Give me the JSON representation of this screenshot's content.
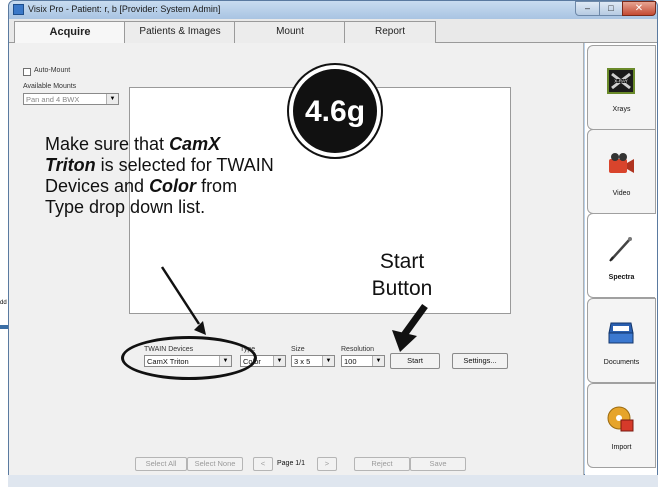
{
  "window": {
    "title": "Visix Pro - Patient: r, b [Provider: System Admin]"
  },
  "tabs": [
    {
      "label": "Acquire",
      "active": true
    },
    {
      "label": "Patients & Images",
      "active": false
    },
    {
      "label": "Mount",
      "active": false
    },
    {
      "label": "Report",
      "active": false
    }
  ],
  "left_panel": {
    "auto_mount_label": "Auto-Mount",
    "available_mounts_label": "Available Mounts",
    "available_mounts_value": "Pan and 4 BWX"
  },
  "controls": {
    "twain_label": "TWAIN Devices",
    "twain_value": "CamX Triton",
    "type_label": "Type",
    "type_value": "Color",
    "size_label": "Size",
    "size_value": "3 x 5",
    "resolution_label": "Resolution",
    "resolution_value": "100",
    "start_label": "Start",
    "settings_label": "Settings..."
  },
  "bottom_bar": {
    "select_all": "Select All",
    "select_none": "Select None",
    "prev": "<",
    "page": "Page 1/1",
    "next": ">",
    "reject": "Reject",
    "save": "Save"
  },
  "sidebar": {
    "items": [
      {
        "label": "Xrays",
        "icon": "xray-icon"
      },
      {
        "label": "Video",
        "icon": "video-camera-icon"
      },
      {
        "label": "Spectra",
        "icon": "spectra-pen-icon"
      },
      {
        "label": "Documents",
        "icon": "scanner-icon"
      },
      {
        "label": "Import",
        "icon": "import-icon"
      }
    ]
  },
  "annotations": {
    "badge": "4.6g",
    "instruction_1": "Make sure that ",
    "instruction_2": "CamX Triton",
    "instruction_3": " is selected for TWAIN Devices and ",
    "instruction_4": "Color",
    "instruction_5": " from Type drop down list.",
    "start_callout": "Start Button"
  },
  "background_fragment": "dd"
}
